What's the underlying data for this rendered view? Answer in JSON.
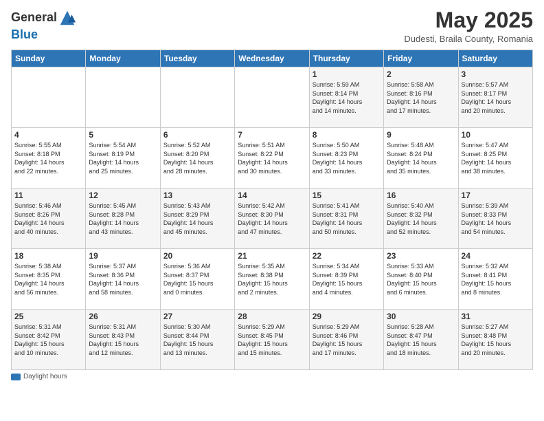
{
  "header": {
    "logo_line1": "General",
    "logo_line2": "Blue",
    "month": "May 2025",
    "location": "Dudesti, Braila County, Romania",
    "legend": "Daylight hours"
  },
  "weekdays": [
    "Sunday",
    "Monday",
    "Tuesday",
    "Wednesday",
    "Thursday",
    "Friday",
    "Saturday"
  ],
  "weeks": [
    [
      {
        "day": "",
        "info": ""
      },
      {
        "day": "",
        "info": ""
      },
      {
        "day": "",
        "info": ""
      },
      {
        "day": "",
        "info": ""
      },
      {
        "day": "1",
        "info": "Sunrise: 5:59 AM\nSunset: 8:14 PM\nDaylight: 14 hours\nand 14 minutes."
      },
      {
        "day": "2",
        "info": "Sunrise: 5:58 AM\nSunset: 8:16 PM\nDaylight: 14 hours\nand 17 minutes."
      },
      {
        "day": "3",
        "info": "Sunrise: 5:57 AM\nSunset: 8:17 PM\nDaylight: 14 hours\nand 20 minutes."
      }
    ],
    [
      {
        "day": "4",
        "info": "Sunrise: 5:55 AM\nSunset: 8:18 PM\nDaylight: 14 hours\nand 22 minutes."
      },
      {
        "day": "5",
        "info": "Sunrise: 5:54 AM\nSunset: 8:19 PM\nDaylight: 14 hours\nand 25 minutes."
      },
      {
        "day": "6",
        "info": "Sunrise: 5:52 AM\nSunset: 8:20 PM\nDaylight: 14 hours\nand 28 minutes."
      },
      {
        "day": "7",
        "info": "Sunrise: 5:51 AM\nSunset: 8:22 PM\nDaylight: 14 hours\nand 30 minutes."
      },
      {
        "day": "8",
        "info": "Sunrise: 5:50 AM\nSunset: 8:23 PM\nDaylight: 14 hours\nand 33 minutes."
      },
      {
        "day": "9",
        "info": "Sunrise: 5:48 AM\nSunset: 8:24 PM\nDaylight: 14 hours\nand 35 minutes."
      },
      {
        "day": "10",
        "info": "Sunrise: 5:47 AM\nSunset: 8:25 PM\nDaylight: 14 hours\nand 38 minutes."
      }
    ],
    [
      {
        "day": "11",
        "info": "Sunrise: 5:46 AM\nSunset: 8:26 PM\nDaylight: 14 hours\nand 40 minutes."
      },
      {
        "day": "12",
        "info": "Sunrise: 5:45 AM\nSunset: 8:28 PM\nDaylight: 14 hours\nand 43 minutes."
      },
      {
        "day": "13",
        "info": "Sunrise: 5:43 AM\nSunset: 8:29 PM\nDaylight: 14 hours\nand 45 minutes."
      },
      {
        "day": "14",
        "info": "Sunrise: 5:42 AM\nSunset: 8:30 PM\nDaylight: 14 hours\nand 47 minutes."
      },
      {
        "day": "15",
        "info": "Sunrise: 5:41 AM\nSunset: 8:31 PM\nDaylight: 14 hours\nand 50 minutes."
      },
      {
        "day": "16",
        "info": "Sunrise: 5:40 AM\nSunset: 8:32 PM\nDaylight: 14 hours\nand 52 minutes."
      },
      {
        "day": "17",
        "info": "Sunrise: 5:39 AM\nSunset: 8:33 PM\nDaylight: 14 hours\nand 54 minutes."
      }
    ],
    [
      {
        "day": "18",
        "info": "Sunrise: 5:38 AM\nSunset: 8:35 PM\nDaylight: 14 hours\nand 56 minutes."
      },
      {
        "day": "19",
        "info": "Sunrise: 5:37 AM\nSunset: 8:36 PM\nDaylight: 14 hours\nand 58 minutes."
      },
      {
        "day": "20",
        "info": "Sunrise: 5:36 AM\nSunset: 8:37 PM\nDaylight: 15 hours\nand 0 minutes."
      },
      {
        "day": "21",
        "info": "Sunrise: 5:35 AM\nSunset: 8:38 PM\nDaylight: 15 hours\nand 2 minutes."
      },
      {
        "day": "22",
        "info": "Sunrise: 5:34 AM\nSunset: 8:39 PM\nDaylight: 15 hours\nand 4 minutes."
      },
      {
        "day": "23",
        "info": "Sunrise: 5:33 AM\nSunset: 8:40 PM\nDaylight: 15 hours\nand 6 minutes."
      },
      {
        "day": "24",
        "info": "Sunrise: 5:32 AM\nSunset: 8:41 PM\nDaylight: 15 hours\nand 8 minutes."
      }
    ],
    [
      {
        "day": "25",
        "info": "Sunrise: 5:31 AM\nSunset: 8:42 PM\nDaylight: 15 hours\nand 10 minutes."
      },
      {
        "day": "26",
        "info": "Sunrise: 5:31 AM\nSunset: 8:43 PM\nDaylight: 15 hours\nand 12 minutes."
      },
      {
        "day": "27",
        "info": "Sunrise: 5:30 AM\nSunset: 8:44 PM\nDaylight: 15 hours\nand 13 minutes."
      },
      {
        "day": "28",
        "info": "Sunrise: 5:29 AM\nSunset: 8:45 PM\nDaylight: 15 hours\nand 15 minutes."
      },
      {
        "day": "29",
        "info": "Sunrise: 5:29 AM\nSunset: 8:46 PM\nDaylight: 15 hours\nand 17 minutes."
      },
      {
        "day": "30",
        "info": "Sunrise: 5:28 AM\nSunset: 8:47 PM\nDaylight: 15 hours\nand 18 minutes."
      },
      {
        "day": "31",
        "info": "Sunrise: 5:27 AM\nSunset: 8:48 PM\nDaylight: 15 hours\nand 20 minutes."
      }
    ]
  ]
}
